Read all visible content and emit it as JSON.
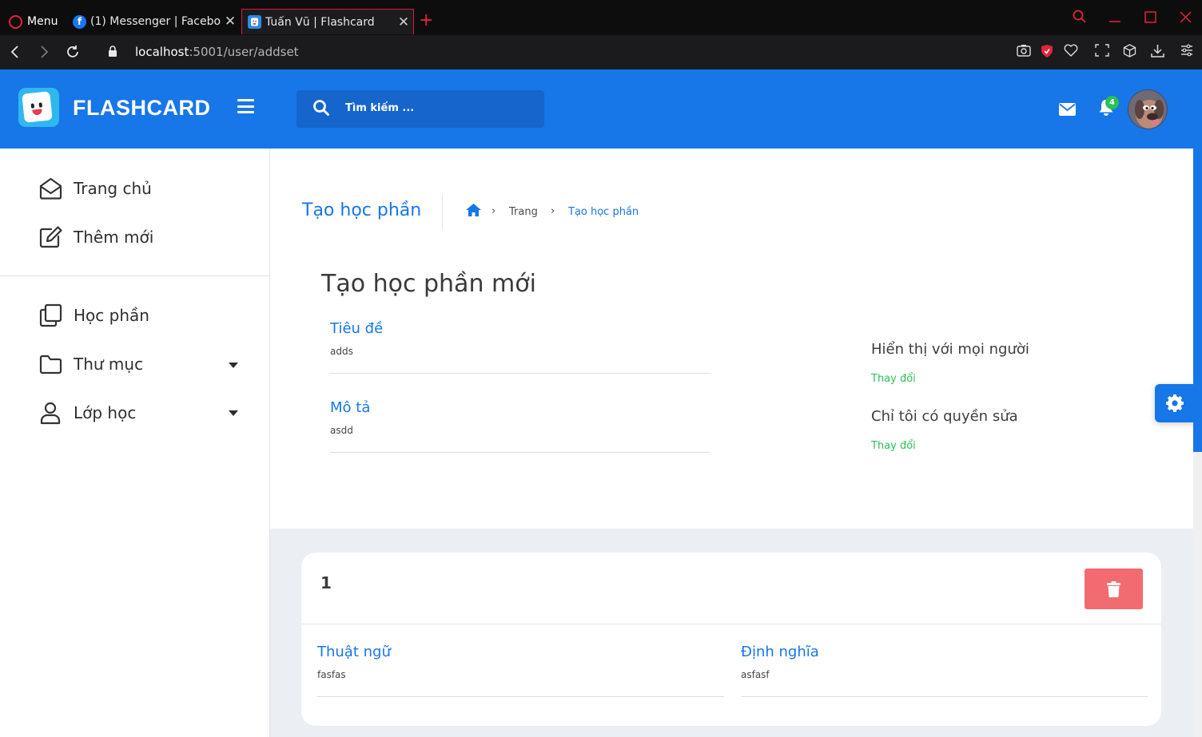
{
  "browser": {
    "menu_label": "Menu",
    "tabs": [
      {
        "title": "(1) Messenger | Facebook",
        "favicon": "f"
      },
      {
        "title": "Tuấn Vũ | Flashcard",
        "favicon": ""
      }
    ],
    "url_host": "localhost",
    "url_path": ":5001/user/addset"
  },
  "header": {
    "brand": "FLASHCARD",
    "search_placeholder": "Tìm kiếm ...",
    "notification_count": "4"
  },
  "sidebar": {
    "items": [
      {
        "label": "Trang chủ"
      },
      {
        "label": "Thêm mới"
      },
      {
        "label": "Học phần"
      },
      {
        "label": "Thư mục"
      },
      {
        "label": "Lớp học"
      }
    ]
  },
  "page": {
    "title": "Tạo học phần",
    "breadcrumb": [
      "Trang",
      "Tạo học phần"
    ],
    "form_title": "Tạo học phần mới",
    "fields": {
      "title_label": "Tiêu đề",
      "title_value": "adds",
      "desc_label": "Mô tả",
      "desc_value": "asdd"
    },
    "options": {
      "visibility_label": "Hiển thị với mọi người",
      "edit_label": "Chỉ tôi có quyền sửa",
      "change_label": "Thay đổi"
    }
  },
  "card": {
    "number": "1",
    "term_label": "Thuật ngữ",
    "term_value": "fasfas",
    "def_label": "Định nghĩa",
    "def_value": "asfasf"
  },
  "colors": {
    "primary": "#1776e8",
    "success": "#2bc155",
    "danger": "#f16b71",
    "opera_red": "#e0243c"
  }
}
